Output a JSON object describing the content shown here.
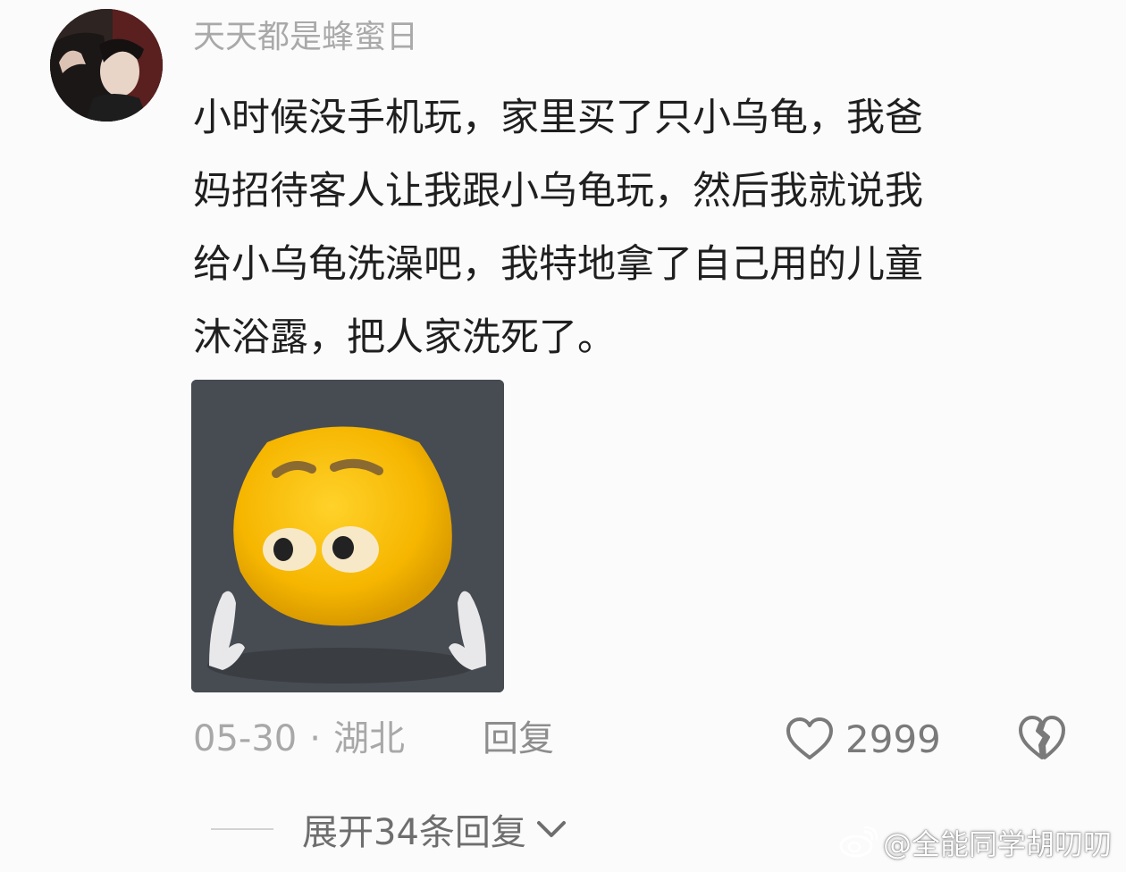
{
  "comment": {
    "username": "天天都是蜂蜜日",
    "text_lines": [
      "小时候没手机玩，家里买了只小乌龟，我爸",
      "妈招待客人让我跟小乌龟玩，然后我就说我",
      "给小乌龟洗澡吧，我特地拿了自己用的儿童",
      "沐浴露，把人家洗死了。"
    ],
    "date": "05-30",
    "separator": "·",
    "location": "湖北",
    "reply_label": "回复",
    "likes": "2999"
  },
  "replies": {
    "expand_label": "展开34条回复"
  },
  "watermark": {
    "text": "@全能同学胡叨叨"
  },
  "icons": {
    "like": "heart-icon",
    "dislike": "broken-heart-icon",
    "expand": "chevron-down-icon",
    "watermark": "weibo-logo-icon"
  },
  "colors": {
    "background": "#fbfbfb",
    "username": "#a9a9a9",
    "text": "#1f1f1f",
    "meta": "#a8a8a8",
    "emoji_yellow": "#f5b800"
  }
}
